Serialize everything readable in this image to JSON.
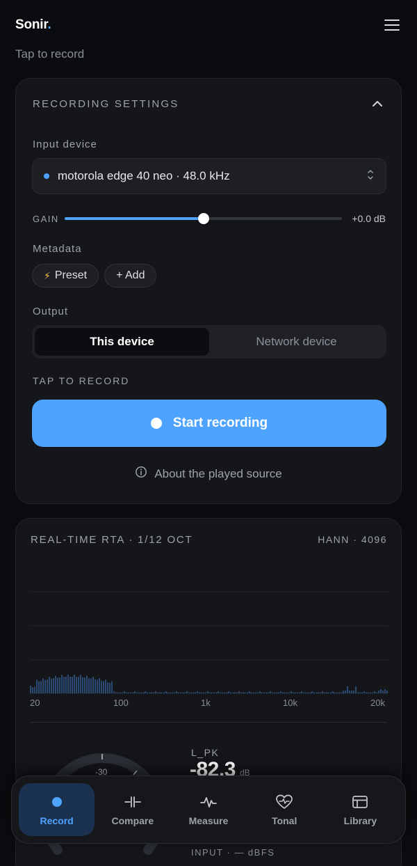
{
  "app": {
    "brand": "Sonir",
    "brand_dot": "."
  },
  "header": {
    "subtitle": "Tap to record",
    "menu_icon": "hamburger-icon"
  },
  "settings": {
    "title": "RECORDING SETTINGS",
    "input_device_label": "Input device",
    "input_device_value": "motorola edge 40 neo · 48.0 kHz",
    "gain_label": "GAIN",
    "gain_value": "+0.0 dB",
    "gain_level": 0.5,
    "metadata_label": "Metadata",
    "chips": [
      {
        "icon": "⚡",
        "label": "Preset"
      },
      {
        "label": "+ Add"
      }
    ],
    "output_label": "Output",
    "output_options": [
      "This device",
      "Network device"
    ],
    "output_selected": "This device",
    "tap_label": "TAP TO RECORD",
    "start_button": "Start recording",
    "about_link": "About the played source"
  },
  "rta": {
    "title": "REAL-TIME RTA · 1/12 OCT",
    "meta": "HANN · 4096",
    "freq_labels": [
      "20",
      "100",
      "1k",
      "10k",
      "20k"
    ],
    "peak_label": "L_PK",
    "peak_value": "-82.3",
    "peak_unit": "dB",
    "dial_label": "-30",
    "input_label": "INPUT · — dBFS"
  },
  "tabbar": {
    "tabs": [
      {
        "label": "Record",
        "icon": "record-dot-icon",
        "active": true
      },
      {
        "label": "Compare",
        "icon": "compare-icon",
        "active": false
      },
      {
        "label": "Measure",
        "icon": "waveform-icon",
        "active": false
      },
      {
        "label": "Tonal",
        "icon": "heart-pulse-icon",
        "active": false
      },
      {
        "label": "Library",
        "icon": "library-icon",
        "active": false
      }
    ]
  },
  "colors": {
    "accent": "#4ea3ff",
    "background": "#0b0c0f",
    "card": "#15161a"
  }
}
